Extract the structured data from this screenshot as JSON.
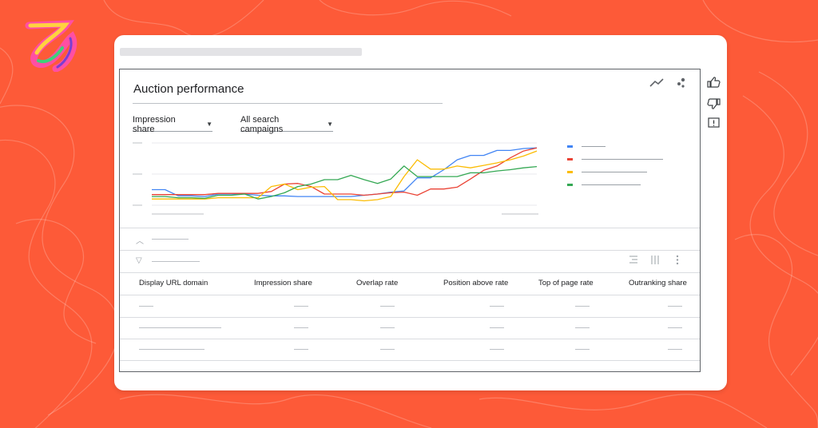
{
  "brand": {
    "background_color": "#fd5a38",
    "logo_icon": "brand-swirl-logo"
  },
  "card": {
    "title": "Auction performance",
    "filters": {
      "metric_selected": "Impression share",
      "campaign_selected": "All search campaigns"
    },
    "chart_icons": [
      "line-chart-icon",
      "scatter-icon"
    ],
    "side_icons": [
      "thumbs-up-icon",
      "thumbs-down-icon",
      "feedback-icon"
    ],
    "table": {
      "columns": [
        "Display URL domain",
        "Impression share",
        "Overlap rate",
        "Position above rate",
        "Top of page rate",
        "Outranking share"
      ]
    }
  },
  "chart_data": {
    "type": "line",
    "title": "",
    "xlabel": "",
    "ylabel": "",
    "x": [
      1,
      2,
      3,
      4,
      5,
      6,
      7,
      8,
      9,
      10,
      11,
      12,
      13,
      14,
      15,
      16,
      17,
      18,
      19,
      20,
      21,
      22,
      23,
      24,
      25,
      26,
      27,
      28,
      29,
      30
    ],
    "ylim": [
      0,
      100
    ],
    "grid": true,
    "legend_position": "right",
    "series": [
      {
        "color": "#4285f4",
        "values": [
          25,
          25,
          15,
          15,
          14,
          18,
          18,
          18,
          16,
          15,
          15,
          14,
          14,
          14,
          14,
          14,
          16,
          18,
          21,
          23,
          44,
          44,
          57,
          73,
          80,
          80,
          88,
          88,
          91,
          92
        ]
      },
      {
        "color": "#ea4335",
        "values": [
          17,
          17,
          17,
          17,
          17,
          19,
          19,
          19,
          19,
          22,
          34,
          35,
          30,
          18,
          18,
          18,
          16,
          18,
          20,
          21,
          16,
          26,
          26,
          29,
          42,
          56,
          63,
          76,
          87,
          92
        ]
      },
      {
        "color": "#fbbc04",
        "values": [
          10,
          10,
          10,
          10,
          10,
          12,
          12,
          12,
          12,
          30,
          34,
          25,
          29,
          30,
          9,
          9,
          7,
          9,
          14,
          46,
          73,
          58,
          58,
          63,
          60,
          64,
          68,
          73,
          79,
          87
        ]
      },
      {
        "color": "#34a853",
        "values": [
          14,
          14,
          12,
          12,
          11,
          16,
          16,
          18,
          10,
          14,
          20,
          30,
          34,
          41,
          41,
          48,
          41,
          35,
          42,
          63,
          46,
          46,
          46,
          46,
          52,
          52,
          55,
          57,
          60,
          62
        ]
      }
    ]
  }
}
